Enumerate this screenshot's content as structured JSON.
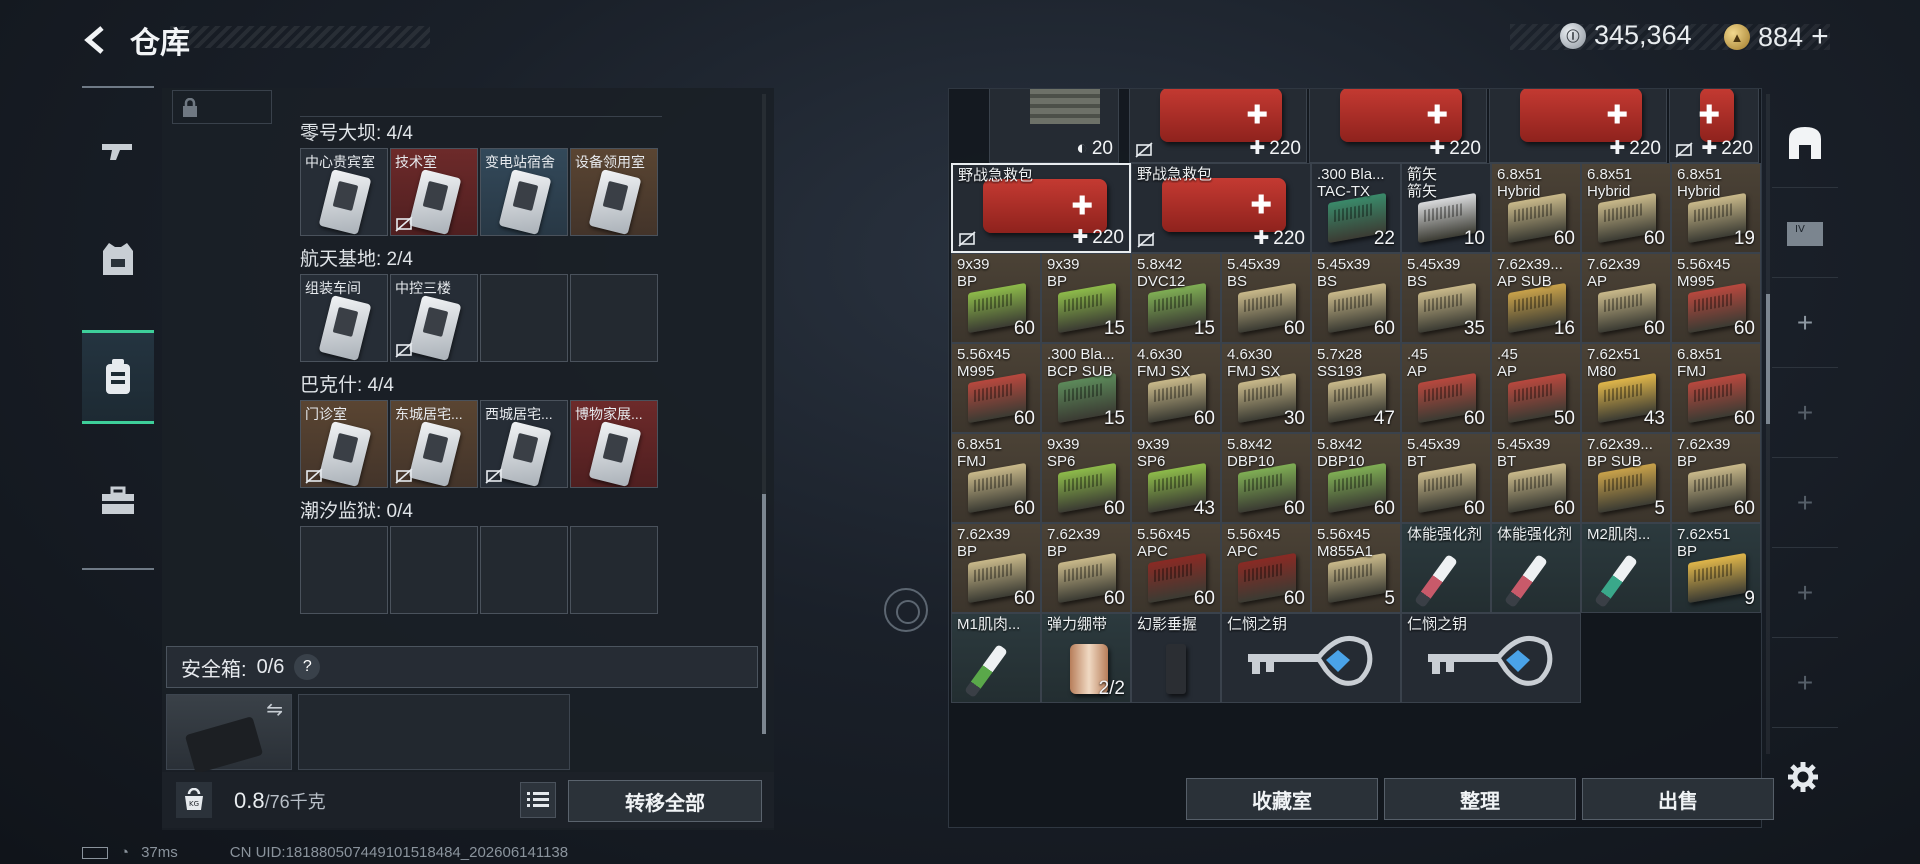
{
  "header": {
    "title": "仓库",
    "currency_silver": "345,364",
    "currency_gold": "884",
    "gold_add": "+"
  },
  "left_nav": [
    {
      "icon": "gun-icon"
    },
    {
      "icon": "armor-vest-icon"
    },
    {
      "icon": "backpack-icon",
      "active": true
    },
    {
      "icon": "toolbox-icon"
    }
  ],
  "key_sections": [
    {
      "title": "零号大坝: 4/4",
      "keys": [
        {
          "label": "中心贵宾室",
          "color": "dark",
          "locked": false
        },
        {
          "label": "技术室",
          "color": "red",
          "locked": true
        },
        {
          "label": "变电站宿舍",
          "color": "blue",
          "locked": false
        },
        {
          "label": "设备领用室",
          "color": "brown",
          "locked": false
        }
      ]
    },
    {
      "title": "航天基地: 2/4",
      "keys": [
        {
          "label": "组装车间",
          "color": "dark",
          "locked": false
        },
        {
          "label": "中控三楼",
          "color": "dark",
          "locked": true
        },
        {
          "label": "",
          "color": "empty",
          "locked": false
        },
        {
          "label": "",
          "color": "empty",
          "locked": false
        }
      ]
    },
    {
      "title": "巴克什: 4/4",
      "keys": [
        {
          "label": "门诊室",
          "color": "brown",
          "locked": true
        },
        {
          "label": "东城居宅...",
          "color": "brown",
          "locked": true
        },
        {
          "label": "西城居宅...",
          "color": "dark",
          "locked": true
        },
        {
          "label": "博物家展...",
          "color": "red",
          "locked": false
        }
      ]
    },
    {
      "title": "潮汐监狱: 0/4",
      "keys": [
        {
          "label": "",
          "color": "empty",
          "locked": false
        },
        {
          "label": "",
          "color": "empty",
          "locked": false
        },
        {
          "label": "",
          "color": "empty",
          "locked": false
        },
        {
          "label": "",
          "color": "empty",
          "locked": false
        }
      ]
    }
  ],
  "safe_box": {
    "label": "安全箱:",
    "count": "0/6",
    "help": "?"
  },
  "weight": {
    "current": "0.8",
    "max": "/76千克"
  },
  "buttons": {
    "transfer_all": "转移全部",
    "collection": "收藏室",
    "organize": "整理",
    "sell": "出售"
  },
  "status": {
    "ping": "37ms",
    "uid": "CN UID:18188050744910151848​4_202606141138"
  },
  "inventory": {
    "top_row": [
      {
        "name": "",
        "qty": "20",
        "kind": "armor"
      },
      {
        "name": "",
        "qty": "220",
        "kind": "medkit",
        "locked": true
      },
      {
        "name": "",
        "qty": "220",
        "kind": "medkit"
      },
      {
        "name": "",
        "qty": "220",
        "kind": "medkit"
      },
      {
        "name": "",
        "qty": "220",
        "kind": "medkit",
        "locked": true
      }
    ],
    "rows": [
      [
        {
          "name": "野战急救包",
          "qty": "220",
          "kind": "medkit",
          "locked": true,
          "selected": true,
          "span": 2
        },
        {
          "name": "野战急救包",
          "qty": "220",
          "kind": "medkit",
          "locked": true,
          "span": 2
        },
        {
          "name": ".300 Bla...\nTAC-TX",
          "qty": "22",
          "kind": "ammo",
          "color": "#3a8a6a"
        },
        {
          "name": "箭矢\n箭矢",
          "qty": "10",
          "kind": "ammo",
          "color": "#d9dadc"
        },
        {
          "name": "6.8x51\nHybrid",
          "qty": "60",
          "kind": "ammo",
          "color": "#c9b98a",
          "tint": "tan"
        },
        {
          "name": "6.8x51\nHybrid",
          "qty": "60",
          "kind": "ammo",
          "color": "#c9b98a",
          "tint": "tan"
        },
        {
          "name": "6.8x51\nHybrid",
          "qty": "19",
          "kind": "ammo",
          "color": "#c9b98a",
          "tint": "tan"
        }
      ],
      [
        {
          "name": "9x39\nBP",
          "qty": "60",
          "kind": "ammo",
          "color": "#8dbb4a",
          "tint": "tan"
        },
        {
          "name": "9x39\nBP",
          "qty": "15",
          "kind": "ammo",
          "color": "#8dbb4a",
          "tint": "tan"
        },
        {
          "name": "5.8x42\nDVC12",
          "qty": "15",
          "kind": "ammo",
          "color": "#7fae54",
          "tint": "tan"
        },
        {
          "name": "5.45x39\nBS",
          "qty": "60",
          "kind": "ammo",
          "color": "#c9b98a",
          "tint": "tan"
        },
        {
          "name": "5.45x39\nBS",
          "qty": "60",
          "kind": "ammo",
          "color": "#c9b98a",
          "tint": "tan"
        },
        {
          "name": "5.45x39\nBS",
          "qty": "35",
          "kind": "ammo",
          "color": "#c9b98a",
          "tint": "tan"
        },
        {
          "name": "7.62x39...\nAP SUB",
          "qty": "16",
          "kind": "ammo",
          "color": "#c9a24a",
          "tint": "tan"
        },
        {
          "name": "7.62x39\nAP",
          "qty": "60",
          "kind": "ammo",
          "color": "#c9b98a",
          "tint": "tan"
        },
        {
          "name": "5.56x45\nM995",
          "qty": "60",
          "kind": "ammo",
          "color": "#b8483e",
          "tint": "tan"
        }
      ],
      [
        {
          "name": "5.56x45\nM995",
          "qty": "60",
          "kind": "ammo",
          "color": "#b8483e",
          "tint": "tan"
        },
        {
          "name": ".300 Bla...\nBCP SUB",
          "qty": "15",
          "kind": "ammo",
          "color": "#5c8a5a",
          "tint": "tan"
        },
        {
          "name": "4.6x30\nFMJ SX",
          "qty": "60",
          "kind": "ammo",
          "color": "#c9b98a",
          "tint": "tan"
        },
        {
          "name": "4.6x30\nFMJ SX",
          "qty": "30",
          "kind": "ammo",
          "color": "#c9b98a",
          "tint": "tan"
        },
        {
          "name": "5.7x28\nSS193",
          "qty": "47",
          "kind": "ammo",
          "color": "#c9b98a",
          "tint": "tan"
        },
        {
          "name": ".45\nAP",
          "qty": "60",
          "kind": "ammo",
          "color": "#b8483e",
          "tint": "tan"
        },
        {
          "name": ".45\nAP",
          "qty": "50",
          "kind": "ammo",
          "color": "#b8483e",
          "tint": "tan"
        },
        {
          "name": "7.62x51\nM80",
          "qty": "43",
          "kind": "ammo",
          "color": "#e0b64a",
          "tint": "tan"
        },
        {
          "name": "6.8x51\nFMJ",
          "qty": "60",
          "kind": "ammo",
          "color": "#b8483e",
          "tint": "tan"
        }
      ],
      [
        {
          "name": "6.8x51\nFMJ",
          "qty": "60",
          "kind": "ammo",
          "color": "#c9b98a",
          "tint": "tan"
        },
        {
          "name": "9x39\nSP6",
          "qty": "60",
          "kind": "ammo",
          "color": "#8dbb4a",
          "tint": "tan"
        },
        {
          "name": "9x39\nSP6",
          "qty": "43",
          "kind": "ammo",
          "color": "#8dbb4a",
          "tint": "tan"
        },
        {
          "name": "5.8x42\nDBP10",
          "qty": "60",
          "kind": "ammo",
          "color": "#7fae54",
          "tint": "tan"
        },
        {
          "name": "5.8x42\nDBP10",
          "qty": "60",
          "kind": "ammo",
          "color": "#7fae54",
          "tint": "tan"
        },
        {
          "name": "5.45x39\nBT",
          "qty": "60",
          "kind": "ammo",
          "color": "#c9b98a",
          "tint": "tan"
        },
        {
          "name": "5.45x39\nBT",
          "qty": "60",
          "kind": "ammo",
          "color": "#c9b98a",
          "tint": "tan"
        },
        {
          "name": "7.62x39...\nBP SUB",
          "qty": "5",
          "kind": "ammo",
          "color": "#c9a24a",
          "tint": "tan"
        },
        {
          "name": "7.62x39\nBP",
          "qty": "60",
          "kind": "ammo",
          "color": "#c9b98a",
          "tint": "tan"
        }
      ],
      [
        {
          "name": "7.62x39\nBP",
          "qty": "60",
          "kind": "ammo",
          "color": "#c9b98a",
          "tint": "tan"
        },
        {
          "name": "7.62x39\nBP",
          "qty": "60",
          "kind": "ammo",
          "color": "#c9b98a",
          "tint": "tan"
        },
        {
          "name": "5.56x45\nAPC",
          "qty": "60",
          "kind": "ammo",
          "color": "#8a2a24",
          "tint": "tan"
        },
        {
          "name": "5.56x45\nAPC",
          "qty": "60",
          "kind": "ammo",
          "color": "#8a2a24",
          "tint": "tan"
        },
        {
          "name": "5.56x45\nM855A1",
          "qty": "5",
          "kind": "ammo",
          "color": "#c9b98a",
          "tint": "tan"
        },
        {
          "name": "体能强化剂",
          "qty": "",
          "kind": "syringe",
          "color": "#c85a6a",
          "tint": "teal"
        },
        {
          "name": "体能强化剂",
          "qty": "",
          "kind": "syringe",
          "color": "#c85a6a",
          "tint": "teal"
        },
        {
          "name": "M2肌肉...",
          "qty": "",
          "kind": "syringe",
          "color": "#3aa88a",
          "tint": "teal"
        },
        {
          "name": "7.62x51\nBP",
          "qty": "9",
          "kind": "ammo",
          "color": "#e0b64a",
          "tint": "teal"
        }
      ],
      [
        {
          "name": "M1肌肉...",
          "qty": "",
          "kind": "syringe",
          "color": "#5aa84a",
          "tint": "teal"
        },
        {
          "name": "弹力绷带",
          "qty": "2/2",
          "kind": "roller",
          "tint": "teal"
        },
        {
          "name": "幻影垂握",
          "qty": "",
          "kind": "grip",
          "tint": "dark"
        },
        {
          "name": "仁悯之钥",
          "qty": "",
          "kind": "key",
          "span": 2,
          "tint": "dark"
        },
        {
          "name": "仁悯之钥",
          "qty": "",
          "kind": "key",
          "span": 2,
          "tint": "dark"
        }
      ]
    ]
  },
  "right_rail": [
    {
      "icon": "stash-icon"
    },
    {
      "icon": "collection-icon"
    },
    {
      "icon": "plus-icon"
    },
    {
      "icon": "plus-icon"
    },
    {
      "icon": "plus-icon"
    },
    {
      "icon": "plus-icon"
    },
    {
      "icon": "plus-icon"
    },
    {
      "icon": "plus-icon"
    }
  ]
}
